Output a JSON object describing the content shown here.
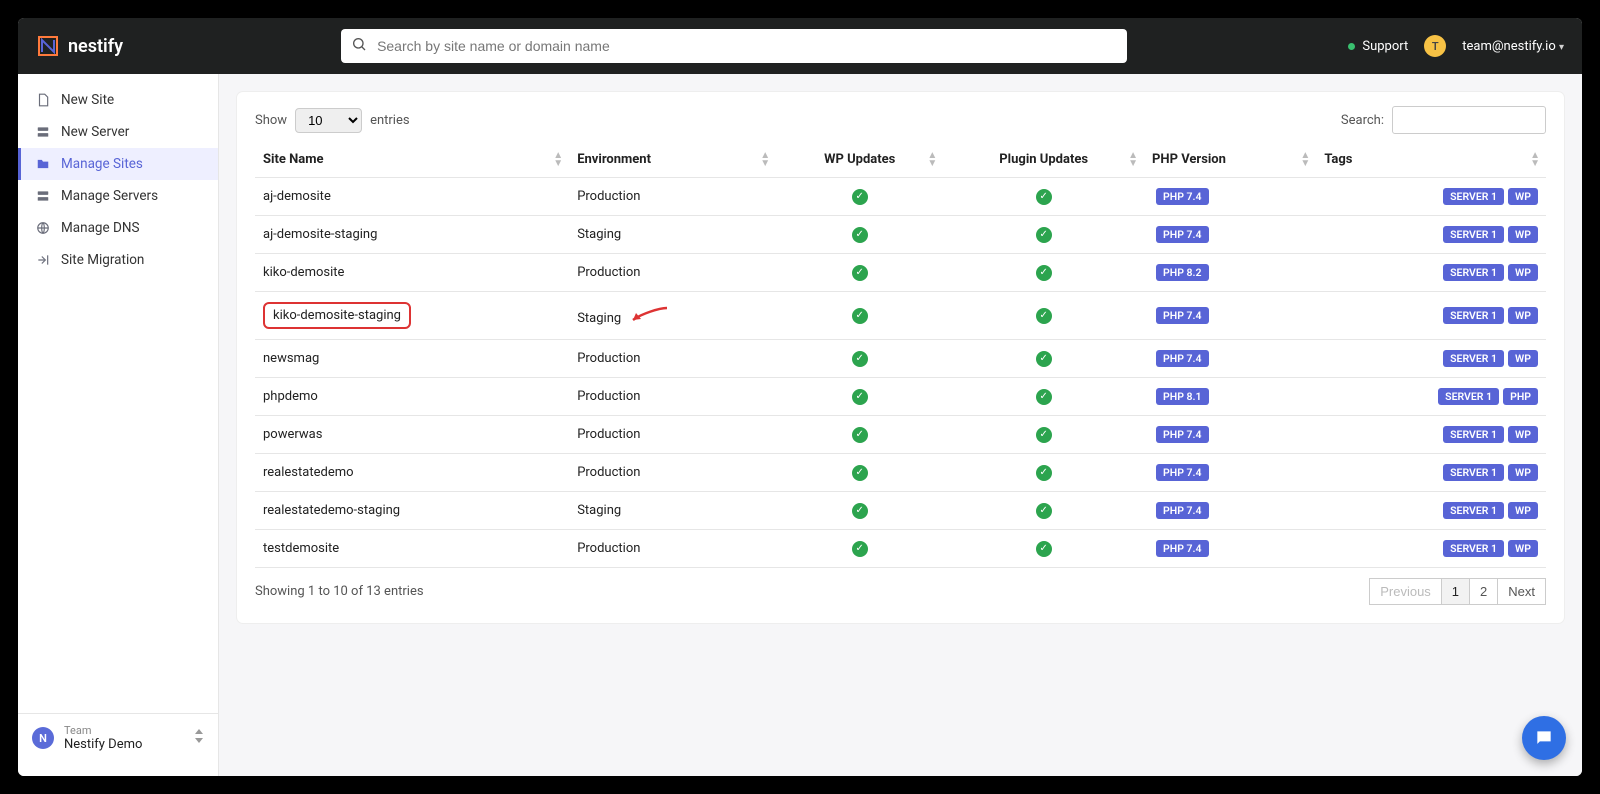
{
  "brand": "nestify",
  "search": {
    "placeholder": "Search by site name or domain name"
  },
  "top": {
    "support": "Support",
    "avatar_initial": "T",
    "user": "team@nestify.io"
  },
  "sidebar": {
    "items": [
      {
        "label": "New Site",
        "icon": "file-icon"
      },
      {
        "label": "New Server",
        "icon": "server-icon"
      },
      {
        "label": "Manage Sites",
        "icon": "folder-icon",
        "active": true
      },
      {
        "label": "Manage Servers",
        "icon": "server-icon"
      },
      {
        "label": "Manage DNS",
        "icon": "globe-icon"
      },
      {
        "label": "Site Migration",
        "icon": "migrate-icon"
      }
    ],
    "team_label": "Team",
    "team_name": "Nestify Demo",
    "team_initial": "N"
  },
  "table": {
    "show_prefix": "Show",
    "show_value": "10",
    "show_suffix": "entries",
    "search_label": "Search:",
    "columns": [
      "Site Name",
      "Environment",
      "WP Updates",
      "Plugin Updates",
      "PHP Version",
      "Tags"
    ],
    "rows": [
      {
        "site": "aj-demosite",
        "env": "Production",
        "php": "PHP 7.4",
        "tags": [
          "SERVER 1",
          "WP"
        ]
      },
      {
        "site": "aj-demosite-staging",
        "env": "Staging",
        "php": "PHP 7.4",
        "tags": [
          "SERVER 1",
          "WP"
        ]
      },
      {
        "site": "kiko-demosite",
        "env": "Production",
        "php": "PHP 8.2",
        "tags": [
          "SERVER 1",
          "WP"
        ]
      },
      {
        "site": "kiko-demosite-staging",
        "env": "Staging",
        "php": "PHP 7.4",
        "tags": [
          "SERVER 1",
          "WP"
        ],
        "highlighted": true,
        "arrow": true
      },
      {
        "site": "newsmag",
        "env": "Production",
        "php": "PHP 7.4",
        "tags": [
          "SERVER 1",
          "WP"
        ]
      },
      {
        "site": "phpdemo",
        "env": "Production",
        "php": "PHP 8.1",
        "tags": [
          "SERVER 1",
          "PHP"
        ]
      },
      {
        "site": "powerwas",
        "env": "Production",
        "php": "PHP 7.4",
        "tags": [
          "SERVER 1",
          "WP"
        ]
      },
      {
        "site": "realestatedemo",
        "env": "Production",
        "php": "PHP 7.4",
        "tags": [
          "SERVER 1",
          "WP"
        ]
      },
      {
        "site": "realestatedemo-staging",
        "env": "Staging",
        "php": "PHP 7.4",
        "tags": [
          "SERVER 1",
          "WP"
        ]
      },
      {
        "site": "testdemosite",
        "env": "Production",
        "php": "PHP 7.4",
        "tags": [
          "SERVER 1",
          "WP"
        ]
      }
    ],
    "footer_text": "Showing 1 to 10 of 13 entries",
    "pager": {
      "previous": "Previous",
      "pages": [
        "1",
        "2"
      ],
      "next": "Next",
      "current": "1"
    }
  }
}
